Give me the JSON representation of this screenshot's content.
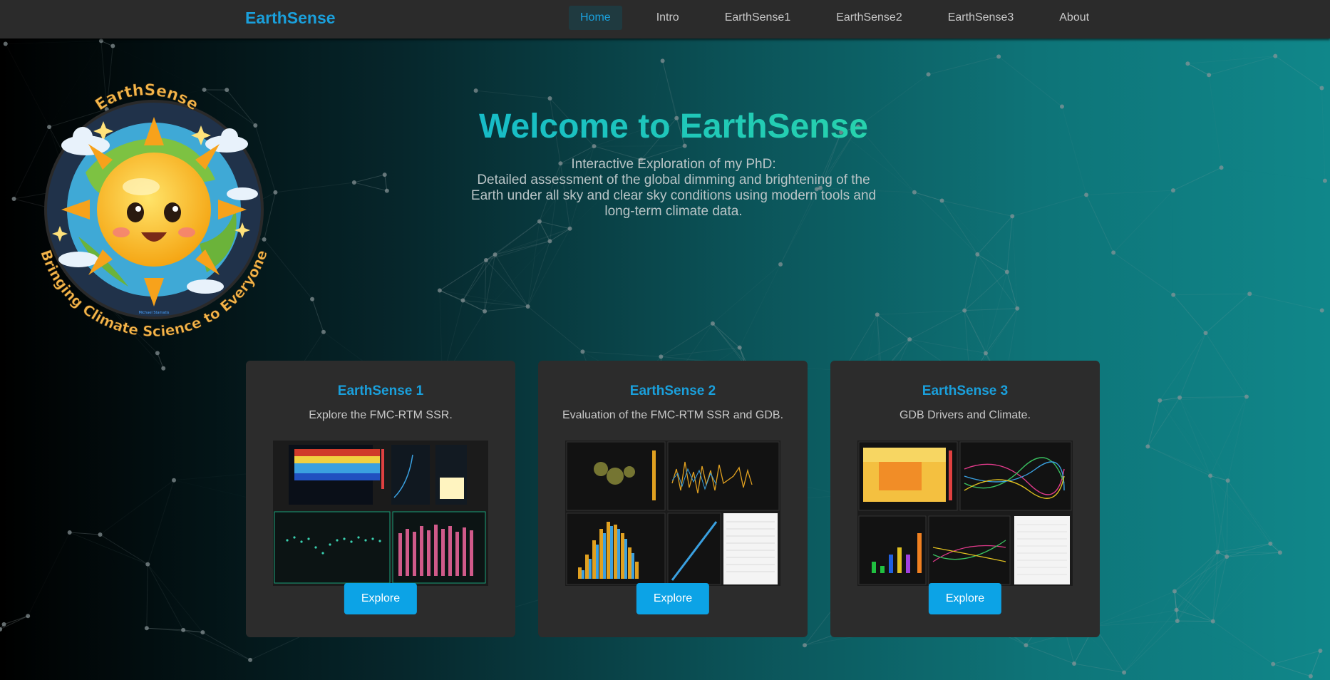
{
  "nav": {
    "brand": "EarthSense",
    "items": [
      {
        "label": "Home",
        "active": true
      },
      {
        "label": "Intro"
      },
      {
        "label": "EarthSense1"
      },
      {
        "label": "EarthSense2"
      },
      {
        "label": "EarthSense3"
      },
      {
        "label": "About"
      }
    ]
  },
  "logo": {
    "title_text": "EarthSense",
    "ring_text": "Bringing Climate Science to Everyone",
    "signature": "Michael Stamatis"
  },
  "hero": {
    "title": "Welcome to EarthSense",
    "subtitle_lines": [
      "Interactive Exploration of my PhD:",
      "Detailed assessment of the global dimming and brightening of the",
      "Earth under all sky and clear sky conditions using modern tools and",
      "long-term climate data."
    ]
  },
  "cards": [
    {
      "title": "EarthSense 1",
      "description": "Explore the FMC-RTM SSR.",
      "button": "Explore",
      "thumb_icon": "dashboard-screenshot-1"
    },
    {
      "title": "EarthSense 2",
      "description": "Evaluation of the FMC-RTM SSR and GDB.",
      "button": "Explore",
      "thumb_icon": "dashboard-screenshot-2"
    },
    {
      "title": "EarthSense 3",
      "description": "GDB Drivers and Climate.",
      "button": "Explore",
      "thumb_icon": "dashboard-screenshot-3"
    }
  ],
  "colors": {
    "accent": "#1aa0dc",
    "button": "#0ca3e6",
    "navbar": "#2b2b2b",
    "card": "#2c2c2c",
    "title_gradient_start": "#14b8cc",
    "title_gradient_end": "#2ad6a8"
  }
}
